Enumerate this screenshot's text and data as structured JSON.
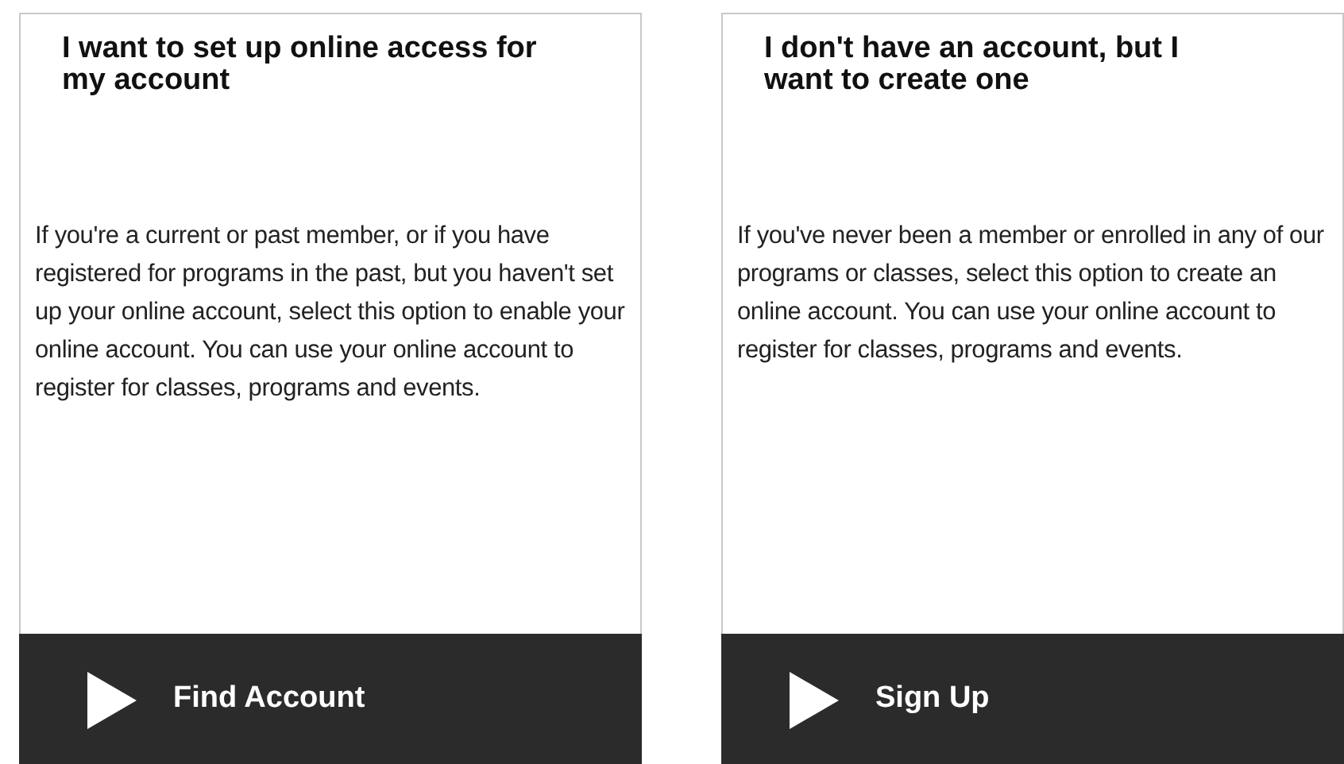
{
  "cards": [
    {
      "title": "I want to set up online access for my account",
      "body": "If you're a current or past member, or if you have registered for programs in the past, but you haven't set up your online account, select this option to enable your online account. You can use your online account to register for classes, programs and events.",
      "action": "Find Account"
    },
    {
      "title": "I don't have an account, but I want to create one",
      "body": "If you've never been a member or enrolled in any of our programs or classes, select this option to create an online account. You can use your online account to register for classes, programs and events.",
      "action": "Sign Up"
    }
  ]
}
